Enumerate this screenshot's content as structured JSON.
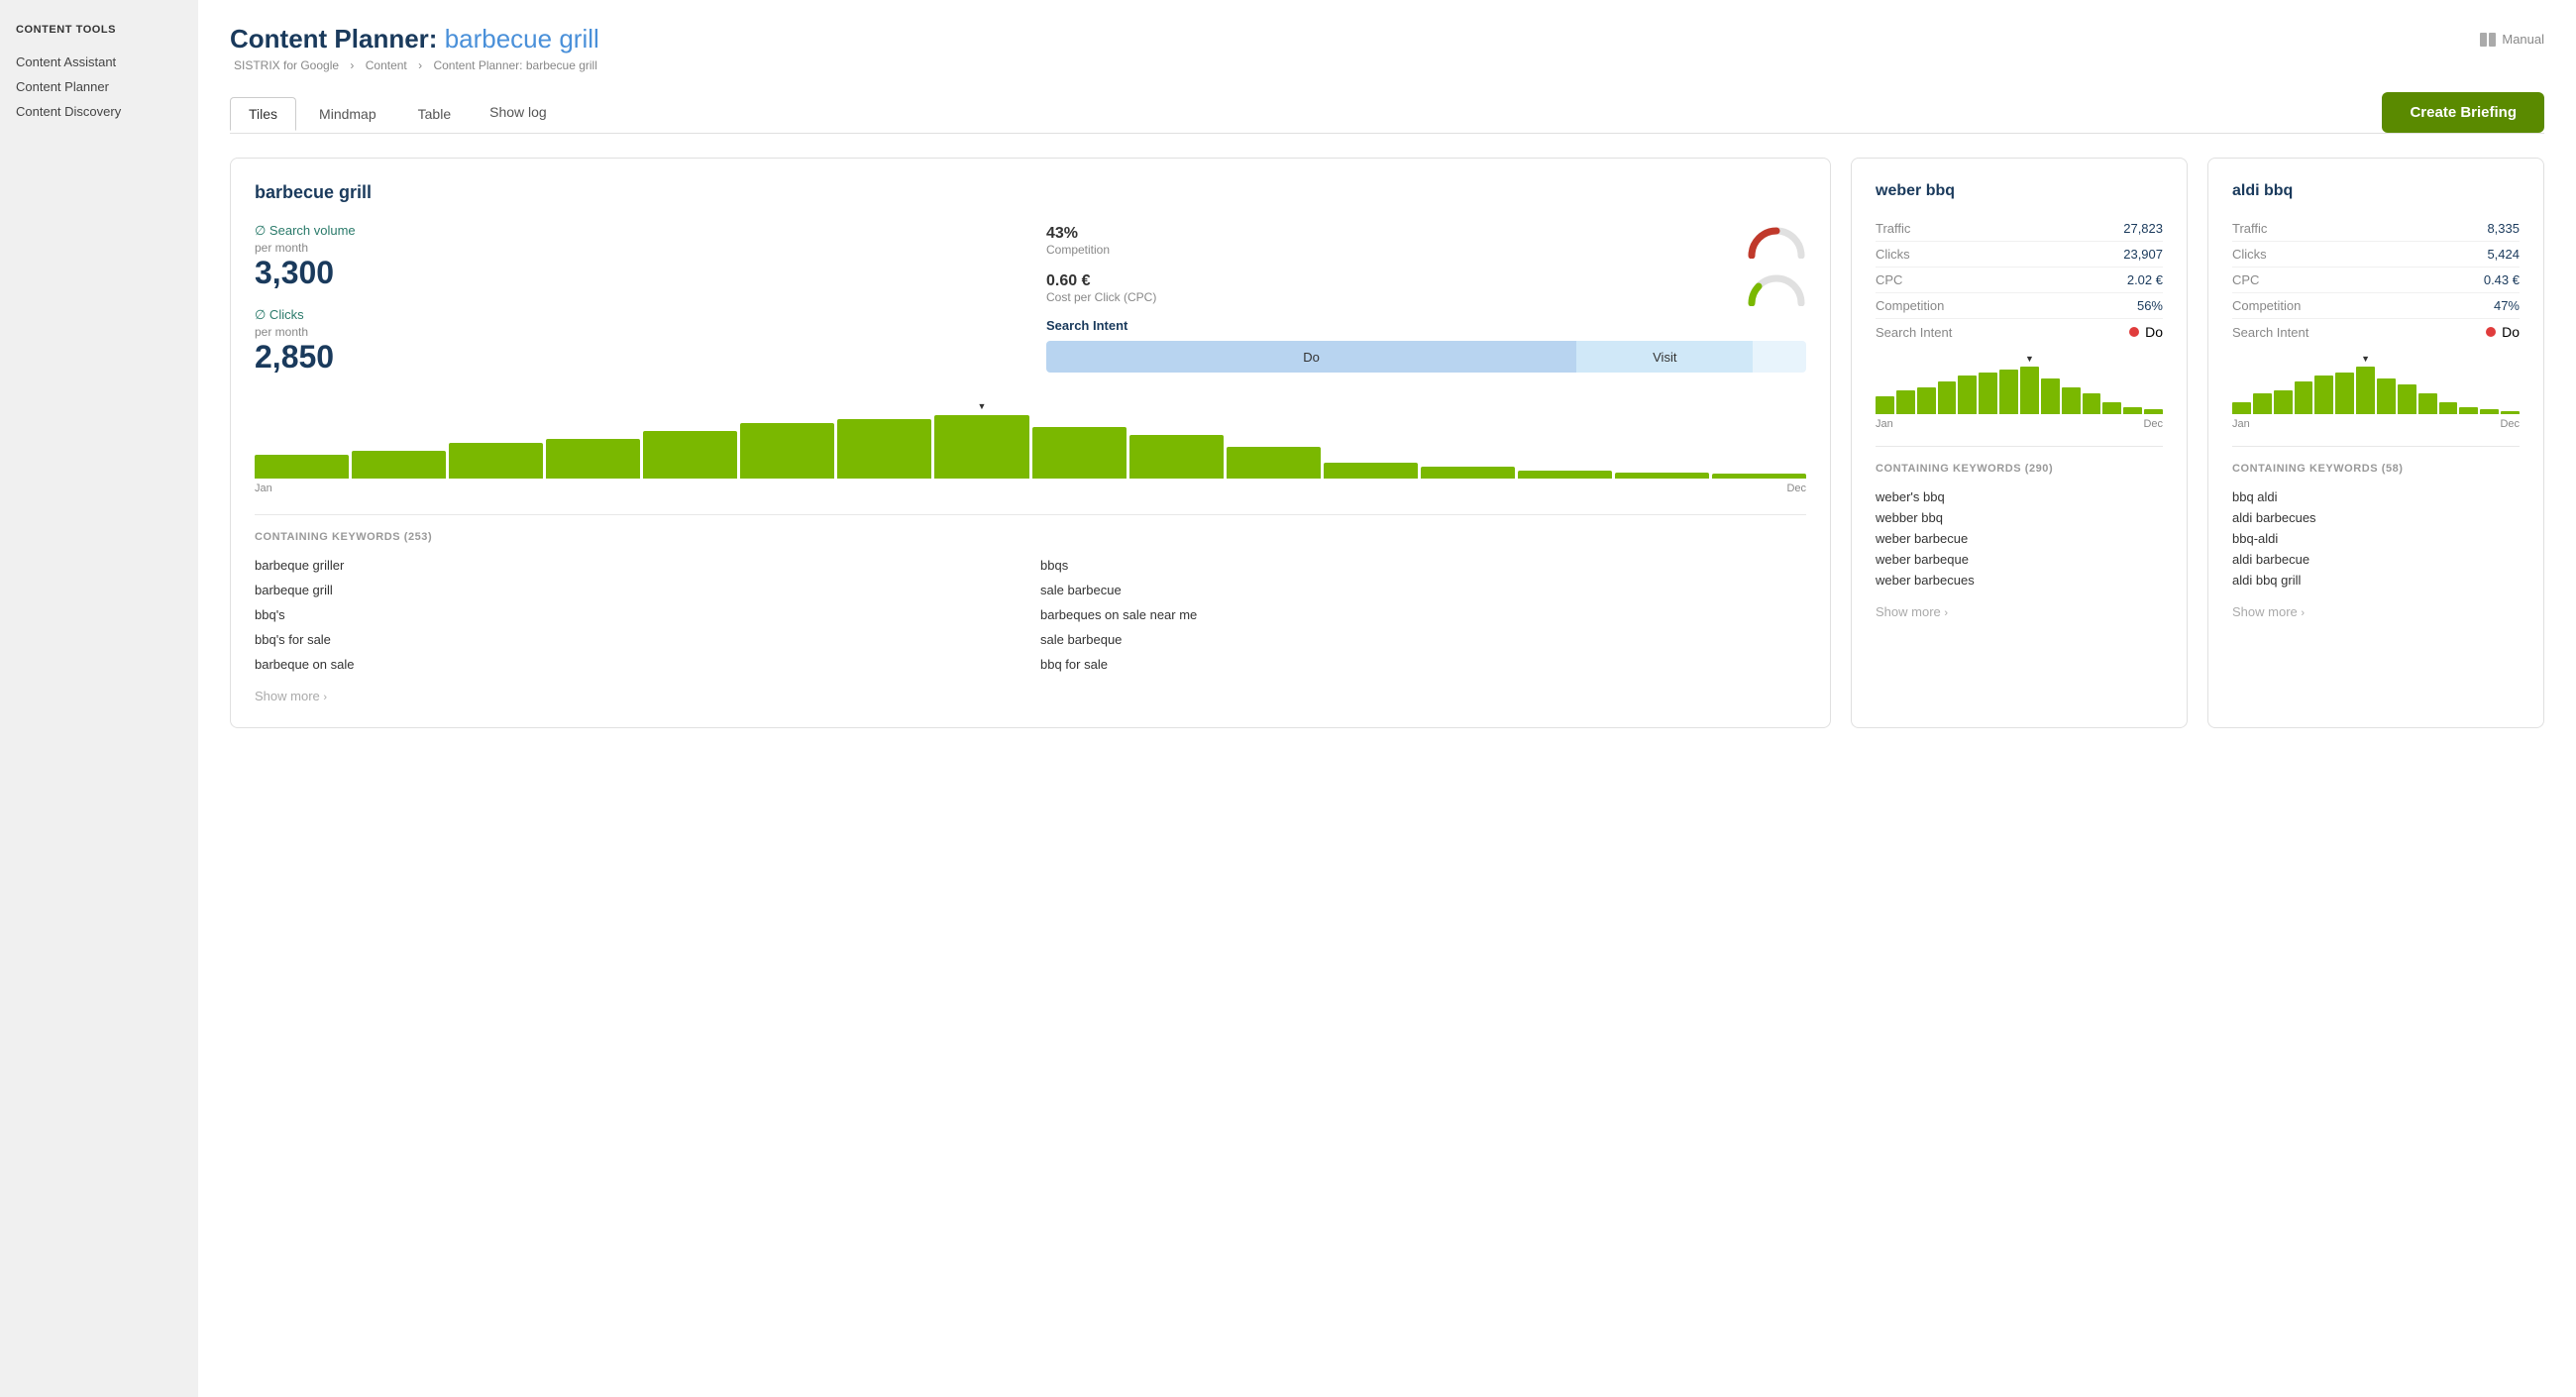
{
  "sidebar": {
    "section_title": "CONTENT TOOLS",
    "items": [
      {
        "label": "Content Assistant",
        "id": "content-assistant"
      },
      {
        "label": "Content Planner",
        "id": "content-planner"
      },
      {
        "label": "Content Discovery",
        "id": "content-discovery"
      }
    ]
  },
  "header": {
    "title_static": "Content Planner:",
    "title_highlight": "barbecue grill",
    "breadcrumb": "SISTRIX for Google  >  Content  >  Content Planner: barbecue grill",
    "breadcrumb_parts": [
      "SISTRIX for Google",
      "Content",
      "Content Planner: barbecue grill"
    ],
    "manual_label": "Manual"
  },
  "tabs": [
    {
      "label": "Tiles",
      "active": true
    },
    {
      "label": "Mindmap",
      "active": false
    },
    {
      "label": "Table",
      "active": false
    }
  ],
  "show_log": "Show log",
  "create_briefing": "Create Briefing",
  "main_card": {
    "title": "barbecue grill",
    "search_volume_label": "∅ Search volume",
    "search_volume_sub": "per month",
    "search_volume_value": "3,300",
    "clicks_label": "∅ Clicks",
    "clicks_sub": "per month",
    "clicks_value": "2,850",
    "competition_value": "43%",
    "competition_label": "Competition",
    "cpc_value": "0.60 €",
    "cpc_label": "Cost per Click (CPC)",
    "chart_label_left": "Jan",
    "chart_label_right": "Dec",
    "search_intent_title": "Search Intent",
    "intent_do": "Do",
    "intent_visit": "Visit",
    "keywords_title": "CONTAINING KEYWORDS (253)",
    "keywords_count": "253",
    "keywords_col1": [
      "barbeque griller",
      "barbeque grill",
      "bbq's",
      "bbq's for sale",
      "barbeque on sale"
    ],
    "keywords_col2": [
      "bbqs",
      "sale barbecue",
      "barbeques on sale near me",
      "sale barbeque",
      "bbq for sale"
    ],
    "show_more": "Show more"
  },
  "weber_card": {
    "title": "weber bbq",
    "stats": [
      {
        "label": "Traffic",
        "value": "27,823"
      },
      {
        "label": "Clicks",
        "value": "23,907"
      },
      {
        "label": "CPC",
        "value": "2.02 €"
      },
      {
        "label": "Competition",
        "value": "56%"
      },
      {
        "label": "Search Intent",
        "value": "Do",
        "dot": true
      }
    ],
    "chart_label_left": "Jan",
    "chart_label_right": "Dec",
    "keywords_title": "CONTAINING KEYWORDS (290)",
    "keywords_count": "290",
    "keywords": [
      "weber's bbq",
      "webber bbq",
      "weber barbecue",
      "weber barbeque",
      "weber barbecues"
    ],
    "show_more": "Show more"
  },
  "aldi_card": {
    "title": "aldi bbq",
    "stats": [
      {
        "label": "Traffic",
        "value": "8,335"
      },
      {
        "label": "Clicks",
        "value": "5,424"
      },
      {
        "label": "CPC",
        "value": "0.43 €"
      },
      {
        "label": "Competition",
        "value": "47%"
      },
      {
        "label": "Search Intent",
        "value": "Do",
        "dot": true
      }
    ],
    "chart_label_left": "Jan",
    "chart_label_right": "Dec",
    "keywords_title": "CONTAINING KEYWORDS (58)",
    "keywords_count": "58",
    "keywords": [
      "bbq aldi",
      "aldi barbecues",
      "bbq-aldi",
      "aldi barbecue",
      "aldi bbq grill"
    ],
    "show_more": "Show more"
  },
  "colors": {
    "accent_green": "#5a8a00",
    "bar_green": "#7ab800",
    "title_blue": "#1a3a5c",
    "link_blue": "#4a90d9",
    "competition_red": "#c0392b",
    "intent_do_bg": "#b8d4f0",
    "intent_visit_bg": "#d0e8f8"
  }
}
